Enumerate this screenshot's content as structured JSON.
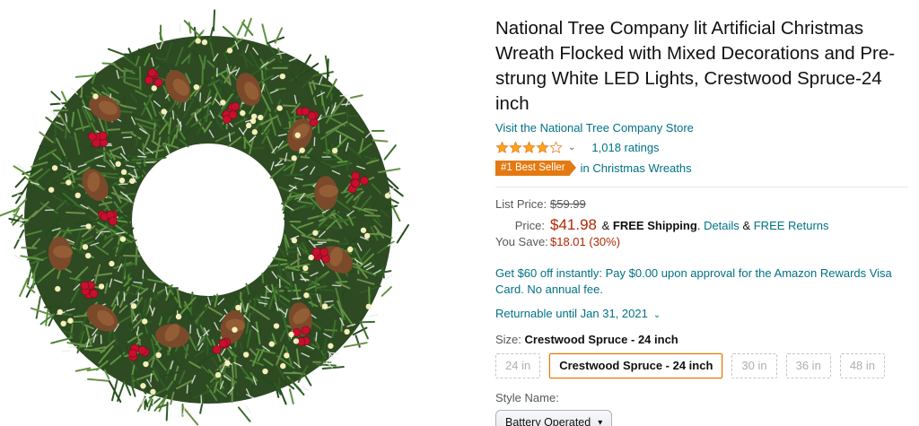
{
  "product": {
    "title": "National Tree Company lit Artificial Christmas Wreath Flocked with Mixed Decorations and Pre-strung White LED Lights, Crestwood Spruce-24 inch",
    "store_link": "Visit the National Tree Company Store",
    "rating_stars": 4,
    "rating_chevron": "⌄",
    "ratings_count": "1,018 ratings",
    "badge": "#1 Best Seller",
    "badge_category": "in Christmas Wreaths"
  },
  "pricing": {
    "list_price_label": "List Price:",
    "list_price": "$59.99",
    "price_label": "Price:",
    "price": "$41.98",
    "amp1": "&",
    "free_shipping": "FREE Shipping",
    "period": ".",
    "details_link": "Details",
    "amp2": "&",
    "free_returns_link": "FREE Returns",
    "you_save_label": "You Save:",
    "you_save": "$18.01 (30%)"
  },
  "promo": "Get $60 off instantly: Pay $0.00 upon approval for the Amazon Rewards Visa Card. No annual fee.",
  "returnable": "Returnable until Jan 31, 2021",
  "size": {
    "label": "Size:",
    "selected": "Crestwood Spruce - 24 inch",
    "options": [
      "24 in",
      "Crestwood Spruce - 24 inch",
      "30 in",
      "36 in",
      "48 in"
    ]
  },
  "style": {
    "label": "Style Name:",
    "selected": "Battery Operated"
  },
  "colors": {
    "link": "#007185",
    "price": "#b12704",
    "badge": "#e47911",
    "selected_border": "#e77600",
    "star": "#ffa41c"
  }
}
